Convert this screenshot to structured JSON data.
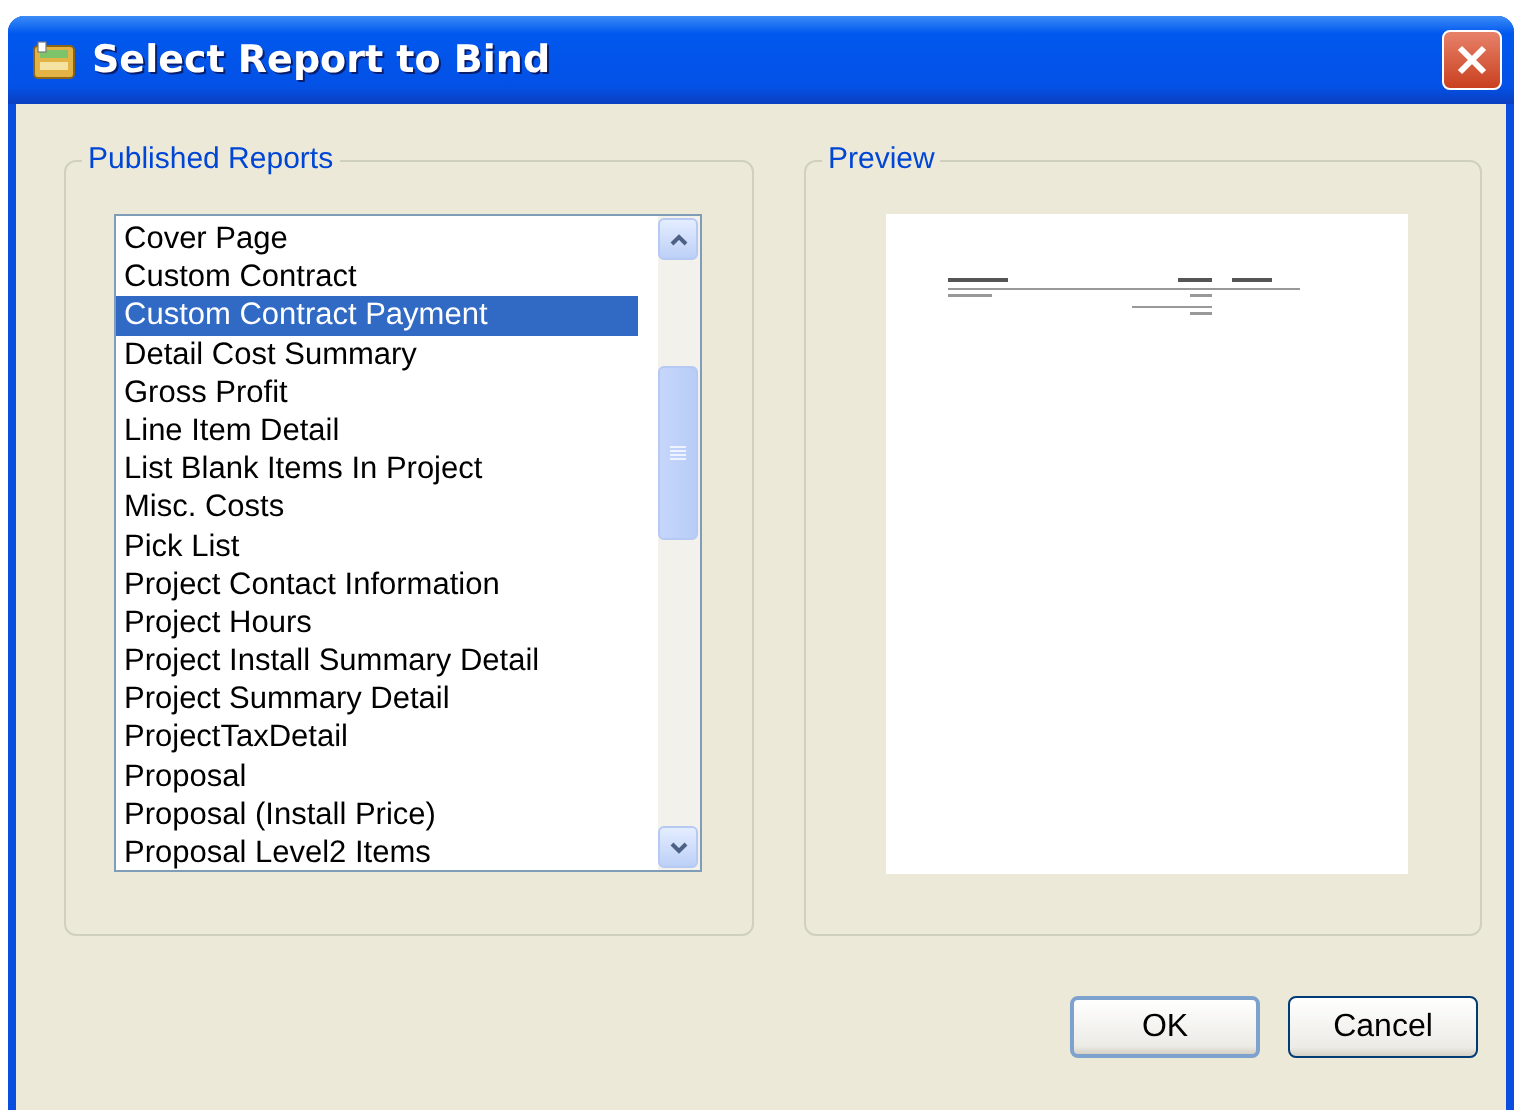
{
  "window": {
    "title": "Select Report to Bind"
  },
  "published_reports": {
    "label": "Published Reports",
    "items": [
      {
        "label": "Cover Page",
        "selected": false
      },
      {
        "label": "Custom Contract",
        "selected": false
      },
      {
        "label": "Custom Contract Payment",
        "selected": true
      },
      {
        "label": "Detail Cost Summary",
        "selected": false
      },
      {
        "label": "Gross Profit",
        "selected": false
      },
      {
        "label": "Line Item Detail",
        "selected": false
      },
      {
        "label": "List Blank Items In Project",
        "selected": false
      },
      {
        "label": "Misc. Costs",
        "selected": false
      },
      {
        "label": "Pick List",
        "selected": false
      },
      {
        "label": "Project Contact Information",
        "selected": false
      },
      {
        "label": "Project Hours",
        "selected": false
      },
      {
        "label": "Project Install Summary Detail",
        "selected": false
      },
      {
        "label": "Project Summary Detail",
        "selected": false
      },
      {
        "label": "ProjectTaxDetail",
        "selected": false
      },
      {
        "label": "Proposal",
        "selected": false
      },
      {
        "label": "Proposal (Install Price)",
        "selected": false
      },
      {
        "label": "Proposal Level2 Items",
        "selected": false
      }
    ]
  },
  "preview": {
    "label": "Preview"
  },
  "buttons": [
    {
      "label": "OK",
      "kind": "default"
    },
    {
      "label": "Cancel",
      "kind": "normal"
    }
  ]
}
